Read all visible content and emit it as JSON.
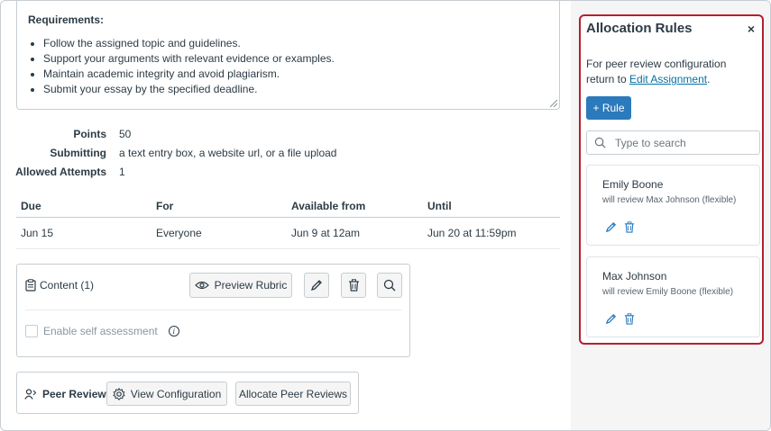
{
  "requirements": {
    "title": "Requirements:",
    "items": [
      "Follow the assigned topic and guidelines.",
      "Support your arguments with relevant evidence or examples.",
      "Maintain academic integrity and avoid plagiarism.",
      "Submit your essay by the specified deadline."
    ]
  },
  "details": {
    "points_label": "Points",
    "points_value": "50",
    "submitting_label": "Submitting",
    "submitting_value": "a text entry box, a website url, or a file upload",
    "attempts_label": "Allowed Attempts",
    "attempts_value": "1"
  },
  "dates": {
    "headers": [
      "Due",
      "For",
      "Available from",
      "Until"
    ],
    "rows": [
      [
        "Jun 15",
        "Everyone",
        "Jun 9 at 12am",
        "Jun 20 at 11:59pm"
      ]
    ]
  },
  "rubric": {
    "content_label": "Content (1)",
    "preview_label": "Preview Rubric",
    "self_assessment_label": "Enable self assessment"
  },
  "peer_review": {
    "label": "Peer Review",
    "view_config_label": "View Configuration",
    "allocate_label": "Allocate Peer Reviews"
  },
  "panel": {
    "title": "Allocation Rules",
    "close": "×",
    "desc_text": "For peer review configuration return to ",
    "desc_link": "Edit Assignment",
    "desc_end": ".",
    "add_rule_label": "+ Rule",
    "search_placeholder": "Type to search",
    "rules": [
      {
        "name": "Emily Boone",
        "detail": "will review Max Johnson (flexible)"
      },
      {
        "name": "Max Johnson",
        "detail": "will review Emily Boone (flexible)"
      }
    ]
  },
  "colors": {
    "accent": "#2b7abc",
    "highlight_border": "#b41f2f",
    "link": "#0770a3"
  }
}
